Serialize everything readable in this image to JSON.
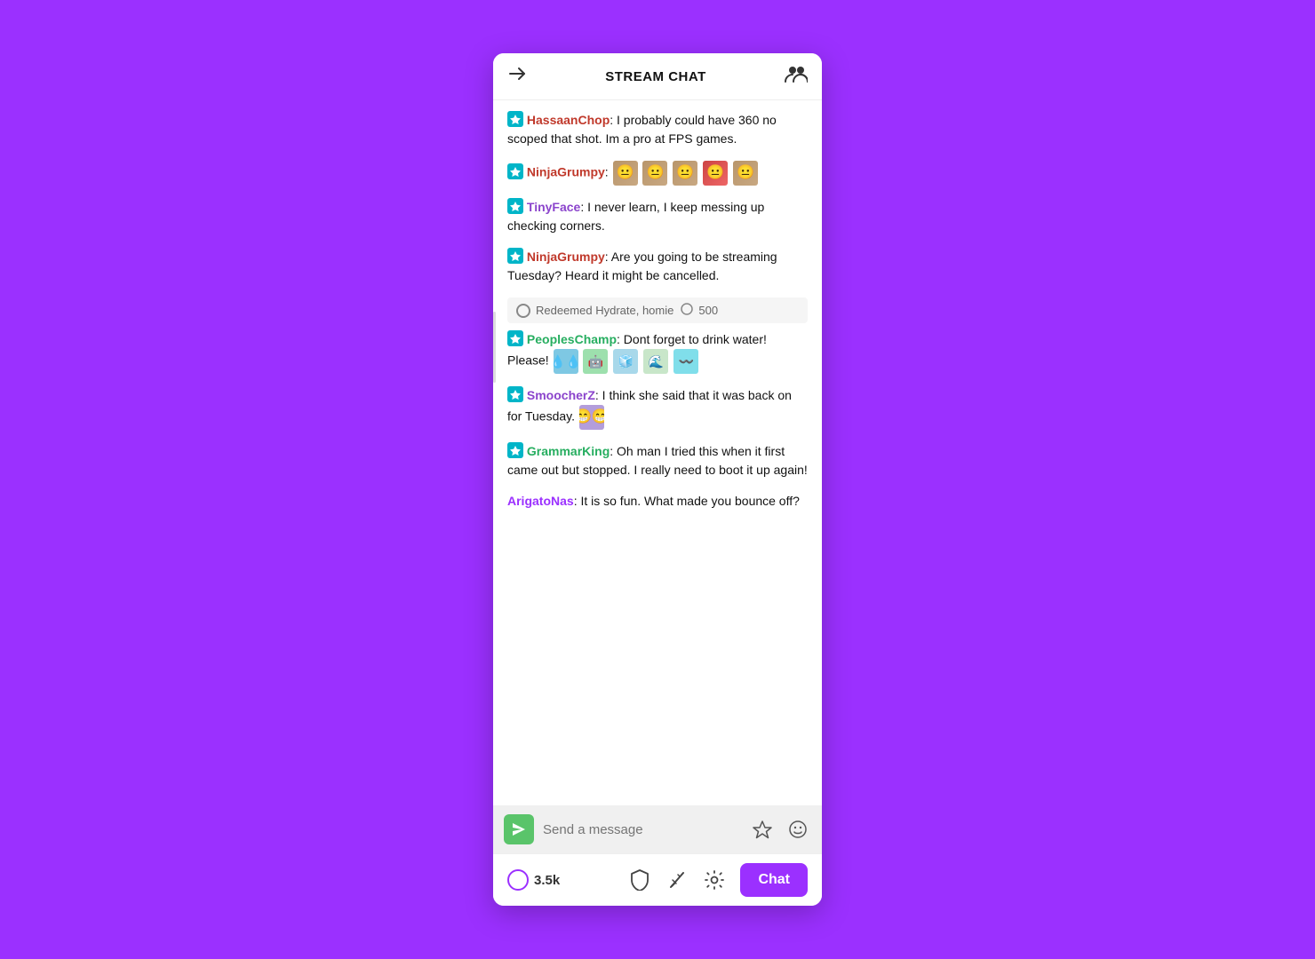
{
  "header": {
    "title": "STREAM CHAT",
    "collapse_icon": "→",
    "users_icon": "👥"
  },
  "messages": [
    {
      "id": "msg1",
      "username": "HassaanChop",
      "username_color": "orange",
      "badge": true,
      "text": ": I probably could have 360 no scoped that shot. Im a pro at FPS games.",
      "emotes": []
    },
    {
      "id": "msg2",
      "username": "NinjaGrumpy",
      "username_color": "orange",
      "badge": true,
      "text": ":",
      "emotes": [
        "face",
        "face",
        "face",
        "face",
        "face"
      ]
    },
    {
      "id": "msg3",
      "username": "TinyFace",
      "username_color": "purple",
      "badge": true,
      "text": ": I never learn, I keep messing up checking corners.",
      "emotes": []
    },
    {
      "id": "msg4",
      "username": "NinjaGrumpy",
      "username_color": "orange",
      "badge": true,
      "text": ": Are you going to be streaming Tuesday? Heard it might be cancelled.",
      "emotes": []
    },
    {
      "id": "redemption",
      "type": "redemption",
      "text": "Redeemed Hydrate, homie",
      "points": "500"
    },
    {
      "id": "msg5",
      "username": "PeoplesChamp",
      "username_color": "green",
      "badge": true,
      "text": ": Dont forget to drink water! Please!",
      "emotes": [
        "hydrate",
        "hydrate",
        "hydrate",
        "hydrate",
        "hydrate"
      ]
    },
    {
      "id": "msg6",
      "username": "SmoocherZ",
      "username_color": "purple",
      "badge": true,
      "text": ": I think she said that it was back on for Tuesday.",
      "emotes": [
        "purple-face"
      ]
    },
    {
      "id": "msg7",
      "username": "GrammarKing",
      "username_color": "green",
      "badge": true,
      "text": ": Oh man I tried this when it first came out but stopped. I really need to boot it up again!",
      "emotes": []
    },
    {
      "id": "msg8",
      "username": "ArigatoNas",
      "username_color": "blue",
      "badge": false,
      "text": ": It is so fun. What made you bounce off?",
      "emotes": []
    }
  ],
  "input": {
    "placeholder": "Send a message"
  },
  "bottom": {
    "viewers": "3.5k",
    "chat_button": "Chat"
  }
}
